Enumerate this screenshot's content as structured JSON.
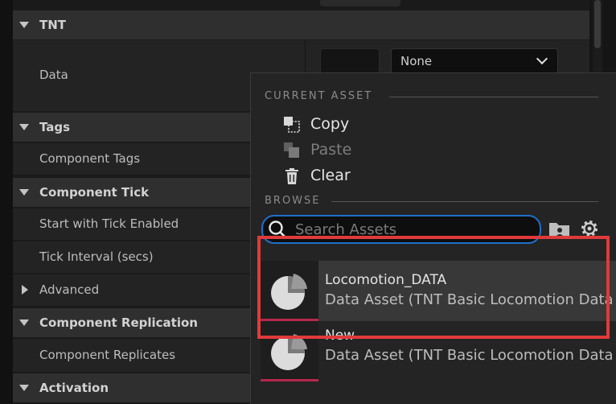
{
  "details": {
    "categories": {
      "tnt": "TNT",
      "tags": "Tags",
      "component_tick": "Component Tick",
      "advanced": "Advanced",
      "component_replication": "Component Replication",
      "activation": "Activation"
    },
    "properties": {
      "data": "Data",
      "component_tags": "Component Tags",
      "start_with_tick_enabled": "Start with Tick Enabled",
      "tick_interval": "Tick Interval (secs)",
      "component_replicates": "Component Replicates"
    },
    "data_combo_value": "None"
  },
  "popup": {
    "current_asset_header": "CURRENT ASSET",
    "browse_header": "BROWSE",
    "menu": {
      "copy": "Copy",
      "paste": "Paste",
      "clear": "Clear"
    },
    "search_placeholder": "Search Assets",
    "assets": [
      {
        "name": "Locomotion_DATA",
        "type": "Data Asset (TNT Basic Locomotion Data"
      },
      {
        "name": "New",
        "type": "Data Asset (TNT Basic Locomotion Data"
      }
    ]
  },
  "colors": {
    "search_focus": "#1f6fc9",
    "asset_bar": "#b5274c",
    "highlight": "#e03a3a"
  }
}
